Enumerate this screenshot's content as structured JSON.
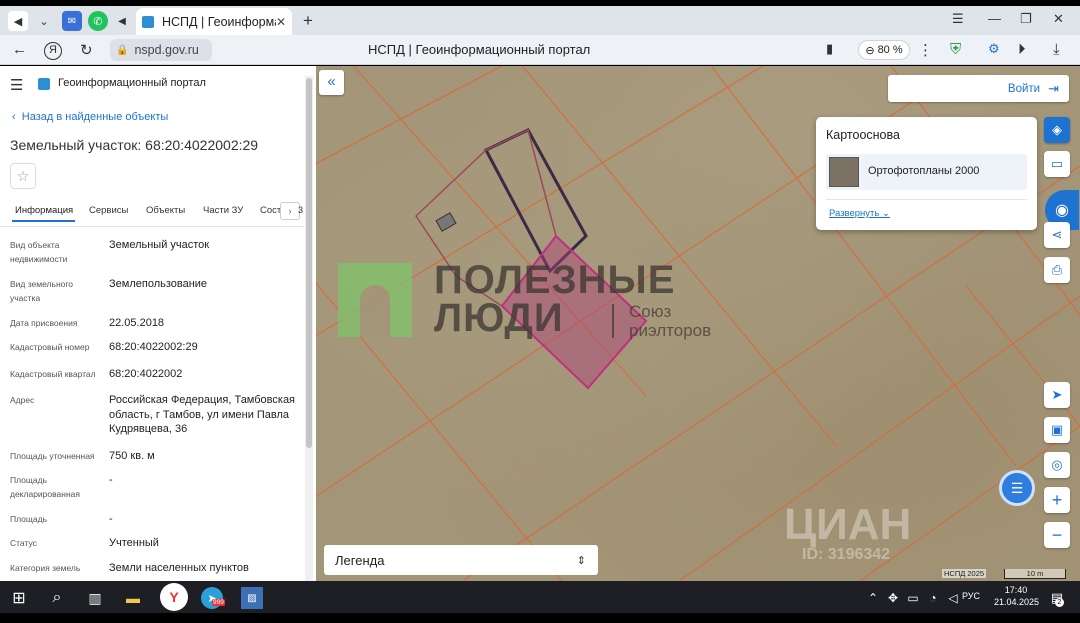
{
  "browser": {
    "tab_title": "НСПД | Геоинформац",
    "url": "nspd.gov.ru",
    "page_title": "НСПД | Геоинформационный портал",
    "zoom": "80 %",
    "new_tab": "+",
    "close_tab": "✕"
  },
  "portal": {
    "title": "Геоинформационный портал",
    "back_link": "Назад в найденные объекты",
    "object_title": "Земельный участок: 68:20:4022002:29",
    "tabs": [
      "Информация",
      "Сервисы",
      "Объекты",
      "Части ЗУ",
      "Сост"
    ],
    "tab_more": "3",
    "fields": [
      {
        "label": "Вид объекта недвижимости",
        "value": "Земельный участок"
      },
      {
        "label": "Вид земельного участка",
        "value": "Землепользование"
      },
      {
        "label": "Дата присвоения",
        "value": "22.05.2018"
      },
      {
        "label": "Кадастровый номер",
        "value": "68:20:4022002:29"
      },
      {
        "label": "Кадастровый квартал",
        "value": "68:20:4022002"
      },
      {
        "label": "Адрес",
        "value": "Российская Федерация, Тамбовская область, г Тамбов, ул имени Павла Кудрявцева, 36"
      },
      {
        "label": "Площадь уточненная",
        "value": "750 кв. м"
      },
      {
        "label": "Площадь декларированная",
        "value": "-"
      },
      {
        "label": "Площадь",
        "value": "-"
      },
      {
        "label": "Статус",
        "value": "Учтенный"
      },
      {
        "label": "Категория земель",
        "value": "Земли населенных пунктов"
      }
    ]
  },
  "map": {
    "login": "Войти",
    "basemap_title": "Картооснова",
    "basemap_layer": "Ортофотопланы 2000",
    "expand": "Развернуть",
    "legend": "Легенда",
    "copyright": "НСПД 2025",
    "scale": "10 m",
    "watermark_title": "ПОЛЕЗНЫЕ",
    "watermark_line2": "ЛЮДИ",
    "watermark_union": "Союз",
    "watermark_realtors": "риэлторов",
    "watermark_cian": "ЦИАН",
    "watermark_id": "ID: 3196342",
    "zoom_in": "+",
    "zoom_out": "−"
  },
  "taskbar": {
    "lang": "РУС",
    "time": "17:40",
    "date": "21.04.2025",
    "notif_count": "2",
    "mail_badge": "999"
  },
  "colors": {
    "accent": "#1e73d2",
    "parcel_fill": "#b0407a",
    "grid_line": "#d86a3c"
  }
}
